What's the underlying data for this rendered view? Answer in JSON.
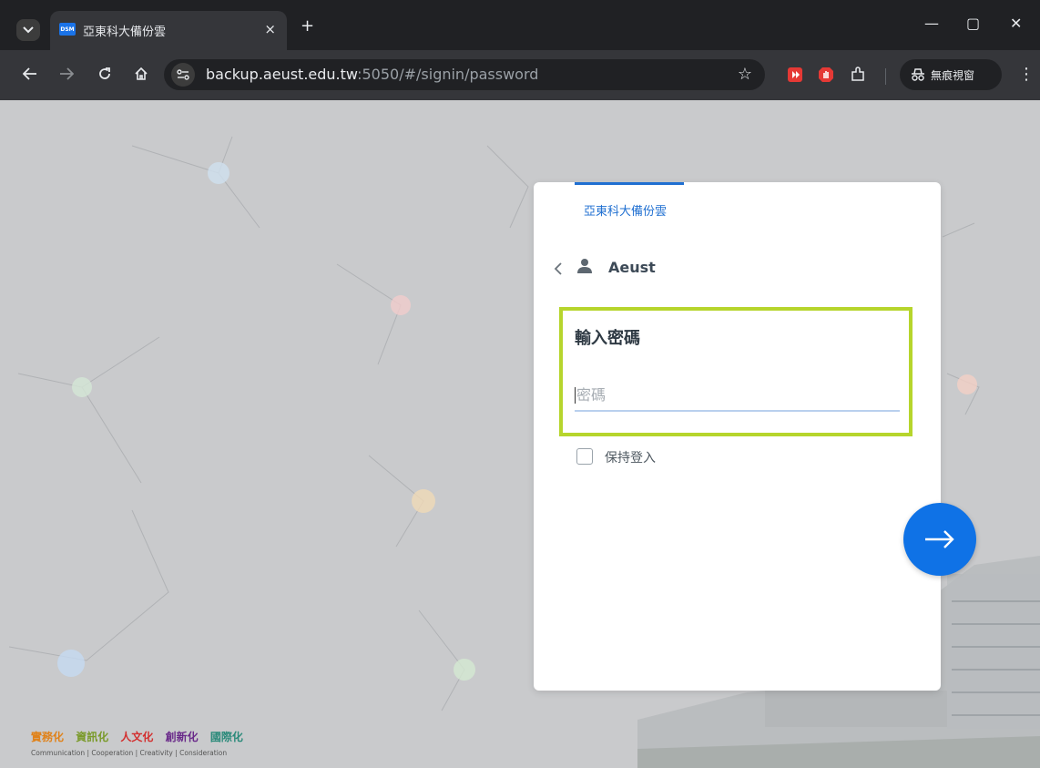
{
  "browser": {
    "tab": {
      "favicon_text": "DSM",
      "title": "亞東科大備份雲",
      "close_glyph": "×"
    },
    "new_tab_glyph": "+",
    "window_controls": {
      "minimize": "—",
      "maximize": "▢",
      "close": "✕"
    },
    "url": {
      "host": "backup.aeust.edu.tw",
      "rest": ":5050/#/signin/password"
    },
    "incognito_label": "無痕視窗",
    "icons": [
      "tab-search-icon",
      "back-arrow-icon",
      "forward-arrow-icon",
      "reload-icon",
      "home-icon",
      "site-info-icon",
      "bookmark-star-icon",
      "extension-icon",
      "menu-icon"
    ]
  },
  "login": {
    "org_tab": "亞東科大備份雲",
    "username": "Aeust",
    "heading": "輸入密碼",
    "password_placeholder": "密碼",
    "stay_signed_in": "保持登入",
    "highlight_color": "#b6d52c",
    "accent_color": "#1f6fd1",
    "next_button_color": "#0f72e6"
  },
  "footer": {
    "slogans": [
      {
        "text": "實務化",
        "color": "#e0821a"
      },
      {
        "text": "資訊化",
        "color": "#7a9a2a"
      },
      {
        "text": "人文化",
        "color": "#d32f2f"
      },
      {
        "text": "創新化",
        "color": "#6a2a8a"
      },
      {
        "text": "國際化",
        "color": "#2a8a7a"
      }
    ],
    "english": "Communication | Cooperation | Creativity | Consideration"
  }
}
